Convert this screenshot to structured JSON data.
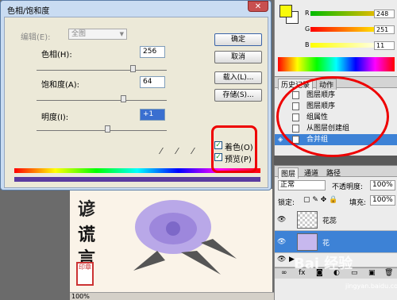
{
  "dialog": {
    "title": "色相/饱和度",
    "close": "✕",
    "edit_label": "编辑(E):",
    "edit_value": "全图",
    "hue_label": "色相(H):",
    "hue_value": "256",
    "sat_label": "饱和度(A):",
    "sat_value": "64",
    "light_label": "明度(I):",
    "light_value": "+1",
    "buttons": {
      "ok": "确定",
      "cancel": "取消",
      "load": "载入(L)...",
      "save": "存储(S)..."
    },
    "colorize_label": "着色(O)",
    "preview_label": "预览(P)",
    "check": "✓"
  },
  "canvas": {
    "chars": [
      "谎",
      "言"
    ],
    "top_char": "谚",
    "seal": "印章"
  },
  "status": {
    "zoom": "100%"
  },
  "color_panel": {
    "r_label": "R",
    "g_label": "G",
    "b_label": "B",
    "r": "248",
    "g": "251",
    "b": "11",
    "fg_color": "#f8fb0b"
  },
  "history": {
    "tabs": [
      "历史记录",
      "动作"
    ],
    "items": [
      "图层顺序",
      "图层顺序",
      "组属性",
      "从图层创建组",
      "合并组"
    ],
    "selected_index": 4
  },
  "layers": {
    "tabs": [
      "图层",
      "通道",
      "路径"
    ],
    "blend_mode": "正常",
    "opacity_label": "不透明度:",
    "opacity": "100%",
    "lock_label": "锁定:",
    "fill_label": "填充:",
    "fill": "100%",
    "items": [
      "花蕊",
      "花"
    ]
  },
  "watermark": {
    "text": "Bai 经验",
    "url": "jingyan.baidu.com"
  }
}
